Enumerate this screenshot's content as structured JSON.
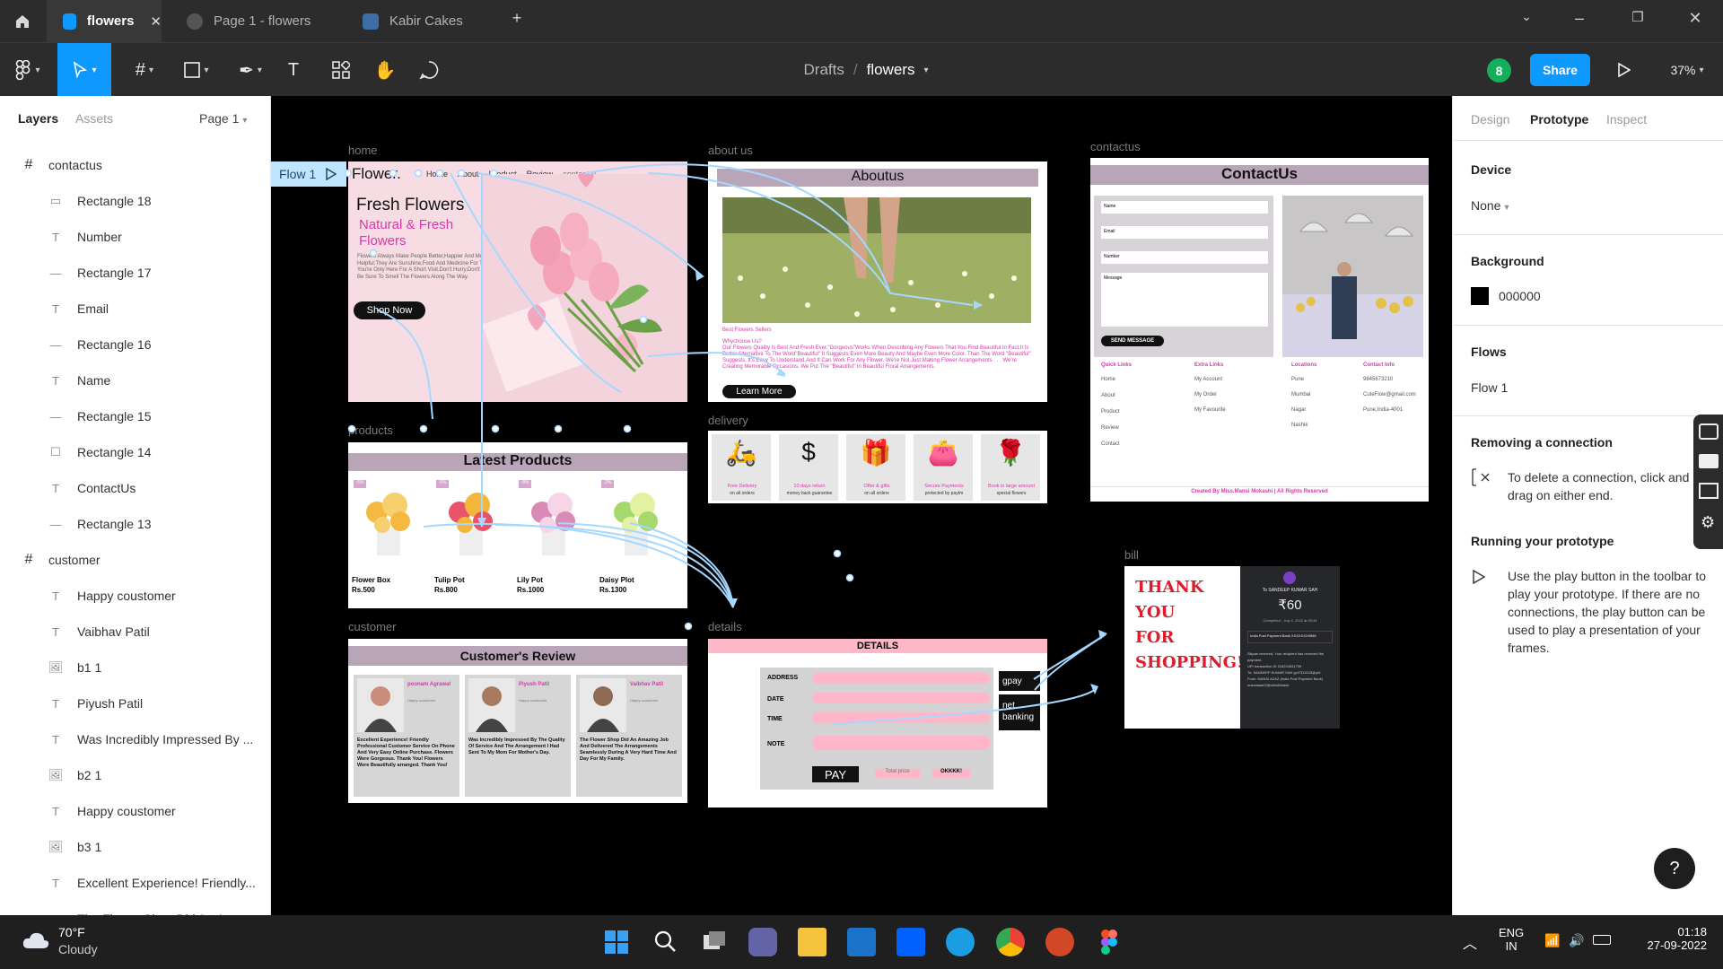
{
  "tabs": [
    {
      "label": "flowers",
      "active": true
    },
    {
      "label": "Page 1 - flowers",
      "active": false
    },
    {
      "label": "Kabir Cakes",
      "active": false
    }
  ],
  "toolbar": {
    "breadcrumb_root": "Drafts",
    "breadcrumb_sep": "/",
    "file_name": "flowers",
    "user_badge": "8",
    "share_label": "Share",
    "zoom": "37%"
  },
  "left_panel": {
    "tab_layers": "Layers",
    "tab_assets": "Assets",
    "page_selector": "Page 1",
    "layers": [
      {
        "label": "contactus",
        "type": "frame"
      },
      {
        "label": "Rectangle 18",
        "type": "rect-line"
      },
      {
        "label": "Number",
        "type": "text"
      },
      {
        "label": "Rectangle 17",
        "type": "line"
      },
      {
        "label": "Email",
        "type": "text"
      },
      {
        "label": "Rectangle 16",
        "type": "line"
      },
      {
        "label": "Name",
        "type": "text"
      },
      {
        "label": "Rectangle 15",
        "type": "line"
      },
      {
        "label": "Rectangle 14",
        "type": "rect"
      },
      {
        "label": "ContactUs",
        "type": "text"
      },
      {
        "label": "Rectangle 13",
        "type": "line"
      },
      {
        "label": "customer",
        "type": "frame"
      },
      {
        "label": "Happy coustomer",
        "type": "text"
      },
      {
        "label": "Vaibhav Patil",
        "type": "text"
      },
      {
        "label": "b1 1",
        "type": "image"
      },
      {
        "label": "Piyush Patil",
        "type": "text"
      },
      {
        "label": "Was Incredibly Impressed By ...",
        "type": "text"
      },
      {
        "label": "b2 1",
        "type": "image"
      },
      {
        "label": "Happy coustomer",
        "type": "text"
      },
      {
        "label": "b3 1",
        "type": "image"
      },
      {
        "label": "Excellent Experience! Friendly...",
        "type": "text"
      },
      {
        "label": "The Flower Shop Did An Ama...",
        "type": "text"
      }
    ]
  },
  "canvas": {
    "frame_labels": {
      "home": "home",
      "about": "about us",
      "contact": "contactus",
      "products": "products",
      "delivery": "delivery",
      "customer": "customer",
      "details": "details",
      "bill": "bill"
    },
    "flow_tag": "Flow 1",
    "home": {
      "logo": "Flower.",
      "nav": [
        "Home",
        "About",
        "Product",
        "Review",
        "contact-u"
      ],
      "headline": "Fresh Flowers",
      "subhead": "Natural & Fresh Flowers",
      "body": "Flowers Always Make People Better,Happier And More Helpful;They Are Sunshine,Food And Medicine For The Soul. You're Only Here For A Short Visit.Don't Hurry,Don't Worry.And Be Sure To Smell The Flowers Along The Way.",
      "cta": "Shop Now"
    },
    "about": {
      "title": "Aboutus",
      "caption": "Best Flowers Sellers",
      "why": "Whychoose Us?",
      "body": "Our Flowers Quality Is Best And Fresh Ever.\"Gorgeous\"Works When Describing Any Flowers That You Find Beautiful In Fact,It Is Better Alternative To The Word\"Beautiful\" It Suggests Even More Beauty And Maybe Even More Color. Than The Word \"Beautiful\" Suggests. It's Easy To Understand,And It Can Work For Any Flower. We're Not Just Making Flower Arrangements . . . We're Creating Memorable Occasions. We Put The \"Beautiful\" In Beautiful Floral Arrangements.",
      "cta": "Learn More"
    },
    "contact": {
      "title": "ContactUs",
      "fields": [
        "Name",
        "Email",
        "Number",
        "Message"
      ],
      "send": "SEND MESSAGE",
      "cols": [
        {
          "head": "Quick Links",
          "items": [
            "Home",
            "About",
            "Product",
            "Review",
            "Contact"
          ]
        },
        {
          "head": "Extra Links",
          "items": [
            "My Account",
            "My Order",
            "My Favourite"
          ]
        },
        {
          "head": "Locations",
          "items": [
            "Pune",
            "Mumbai",
            "Nagar",
            "Nashik"
          ]
        },
        {
          "head": "Contact Info",
          "items": [
            "9845673210",
            "CuteFlow@gmail.com",
            "Pune,India-4001"
          ]
        }
      ],
      "footer": "Created By Miss.Mansi Mokashi | All Rights Reserved"
    },
    "products": {
      "title": "Latest Products",
      "items": [
        {
          "name": "Flower Box",
          "price": "Rs.500",
          "badge": "-5%"
        },
        {
          "name": "Tulip Pot",
          "price": "Rs.800",
          "badge": "-6%"
        },
        {
          "name": "Lily Pot",
          "price": "Rs.1000",
          "badge": "-8%"
        },
        {
          "name": "Daisy Plot",
          "price": "Rs.1300",
          "badge": "-2%"
        }
      ]
    },
    "delivery": {
      "items": [
        {
          "title": "Free Delivery",
          "sub": "on all orders"
        },
        {
          "title": "10 days return",
          "sub": "money back guarantee"
        },
        {
          "title": "Offer & gifts",
          "sub": "on all orders"
        },
        {
          "title": "Secure Payments",
          "sub": "protected by paytm"
        },
        {
          "title": "Book in large amount",
          "sub": "special flowers"
        }
      ]
    },
    "customer": {
      "title": "Customer's Review",
      "reviews": [
        {
          "name": "poonam Agrawal",
          "tag": "Happy coustomer",
          "text": "Excellent Experience! Friendly Professional Customer Service On Phone And Very Easy Online Purchase. Flowers Were Gorgeous. Thank You! Flowers Were Beautifully arranged. Thank You!"
        },
        {
          "name": "Piyush Patil",
          "tag": "Happy coustomer",
          "text": "Was Incredibly Impressed By The Quality Of Service And The Arrangement I Had Sent To My Mom For Mother's Day."
        },
        {
          "name": "Vaibhav Patil",
          "tag": "Happy coustomer",
          "text": "The Flower Shop Did An Amazing Job And Delivered The Arrangements Seamlessly During A Very Hard Time And Day For My Family."
        }
      ]
    },
    "details": {
      "title": "DETAILS",
      "labels": [
        "ADDRESS",
        "DATE",
        "TIME",
        "NOTE"
      ],
      "pay": "PAY",
      "btn2": "Total price",
      "btn3": "OKKKK!",
      "opt1": "gpay",
      "opt2": "net banking"
    },
    "bill": {
      "thanks": "THANK YOU FOR SHOPPING!",
      "receipt_to": "To SANDEEP KUMAR SAH",
      "amount": "₹60",
      "status": "Completed - July 2, 2022 at 09:34",
      "bank": "India Post Payment Bank XXXXXXX9966",
      "lines": [
        "Sikpas received. Your recipient has received the payment.",
        "UPI transaction ID 218224541759",
        "To: SANDEEP KUMAR SAH ypl7313103@ybl",
        "From: MANSI AZAZ (India Post Payment Bank) mansiaaa02@okhdfcbank"
      ]
    }
  },
  "right_panel": {
    "tabs": [
      "Design",
      "Prototype",
      "Inspect"
    ],
    "active_tab": "Prototype",
    "device_heading": "Device",
    "device_value": "None",
    "background_heading": "Background",
    "background_value": "000000",
    "flows_heading": "Flows",
    "flow_item": "Flow 1",
    "removing_heading": "Removing a connection",
    "removing_text": "To delete a connection, click and drag on either end.",
    "running_heading": "Running your prototype",
    "running_text": "Use the play button in the toolbar to play your prototype. If there are no connections, the play button can be used to play a presentation of your frames.",
    "help": "?"
  },
  "taskbar": {
    "temp": "70°F",
    "weather": "Cloudy",
    "lang1": "ENG",
    "lang2": "IN",
    "time": "01:18",
    "date": "27-09-2022"
  },
  "colors": {
    "accent": "#0d99ff",
    "badge_green": "#14ae5c",
    "flow_line": "#9fd5ff",
    "brand_pink": "#d63aa8",
    "title_bar_purple": "#b8a6b8",
    "pink_field": "#ffb6c9"
  }
}
